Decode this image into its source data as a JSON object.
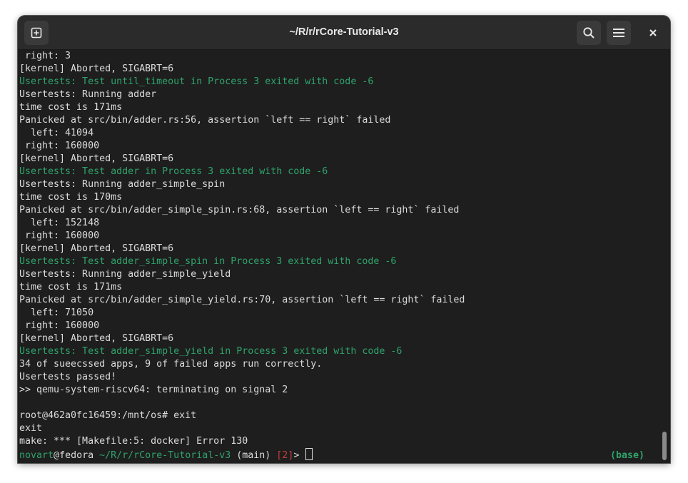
{
  "window": {
    "title": "~/R/r/rCore-Tutorial-v3"
  },
  "titlebar": {
    "new_tab_icon": "new-tab-icon",
    "search_icon": "search-icon",
    "menu_icon": "hamburger-menu-icon",
    "close_icon": "close-icon"
  },
  "terminal": {
    "lines": [
      {
        "text": " right: 3",
        "color": "default"
      },
      {
        "text": "[kernel] Aborted, SIGABRT=6",
        "color": "default"
      },
      {
        "text": "Usertests: Test until_timeout in Process 3 exited with code -6",
        "color": "green"
      },
      {
        "text": "Usertests: Running adder",
        "color": "default"
      },
      {
        "text": "time cost is 171ms",
        "color": "default"
      },
      {
        "text": "Panicked at src/bin/adder.rs:56, assertion `left == right` failed",
        "color": "default"
      },
      {
        "text": "  left: 41094",
        "color": "default"
      },
      {
        "text": " right: 160000",
        "color": "default"
      },
      {
        "text": "[kernel] Aborted, SIGABRT=6",
        "color": "default"
      },
      {
        "text": "Usertests: Test adder in Process 3 exited with code -6",
        "color": "green"
      },
      {
        "text": "Usertests: Running adder_simple_spin",
        "color": "default"
      },
      {
        "text": "time cost is 170ms",
        "color": "default"
      },
      {
        "text": "Panicked at src/bin/adder_simple_spin.rs:68, assertion `left == right` failed",
        "color": "default"
      },
      {
        "text": "  left: 152148",
        "color": "default"
      },
      {
        "text": " right: 160000",
        "color": "default"
      },
      {
        "text": "[kernel] Aborted, SIGABRT=6",
        "color": "default"
      },
      {
        "text": "Usertests: Test adder_simple_spin in Process 3 exited with code -6",
        "color": "green"
      },
      {
        "text": "Usertests: Running adder_simple_yield",
        "color": "default"
      },
      {
        "text": "time cost is 171ms",
        "color": "default"
      },
      {
        "text": "Panicked at src/bin/adder_simple_yield.rs:70, assertion `left == right` failed",
        "color": "default"
      },
      {
        "text": "  left: 71050",
        "color": "default"
      },
      {
        "text": " right: 160000",
        "color": "default"
      },
      {
        "text": "[kernel] Aborted, SIGABRT=6",
        "color": "default"
      },
      {
        "text": "Usertests: Test adder_simple_yield in Process 3 exited with code -6",
        "color": "green"
      },
      {
        "text": "34 of sueecssed apps, 9 of failed apps run correctly.",
        "color": "default"
      },
      {
        "text": "Usertests passed!",
        "color": "default"
      },
      {
        "text": ">> qemu-system-riscv64: terminating on signal 2",
        "color": "default"
      },
      {
        "text": "",
        "color": "default"
      },
      {
        "text": "root@462a0fc16459:/mnt/os# exit",
        "color": "default"
      },
      {
        "text": "exit",
        "color": "default"
      },
      {
        "text": "make: *** [Makefile:5: docker] Error 130",
        "color": "default"
      }
    ],
    "prompt": {
      "user": "novart",
      "at": "@",
      "host": "fedora",
      "path": " ~/R/r/rCore-Tutorial-v3",
      "branch": " (main)",
      "status_code": " [2]",
      "symbol": "> "
    },
    "right_prompt": "(base)"
  },
  "colors": {
    "background": "#1e1e1e",
    "titlebar": "#2b2b2b",
    "text": "#dcdcdc",
    "green": "#2fa36b",
    "red": "#c53d3d"
  }
}
